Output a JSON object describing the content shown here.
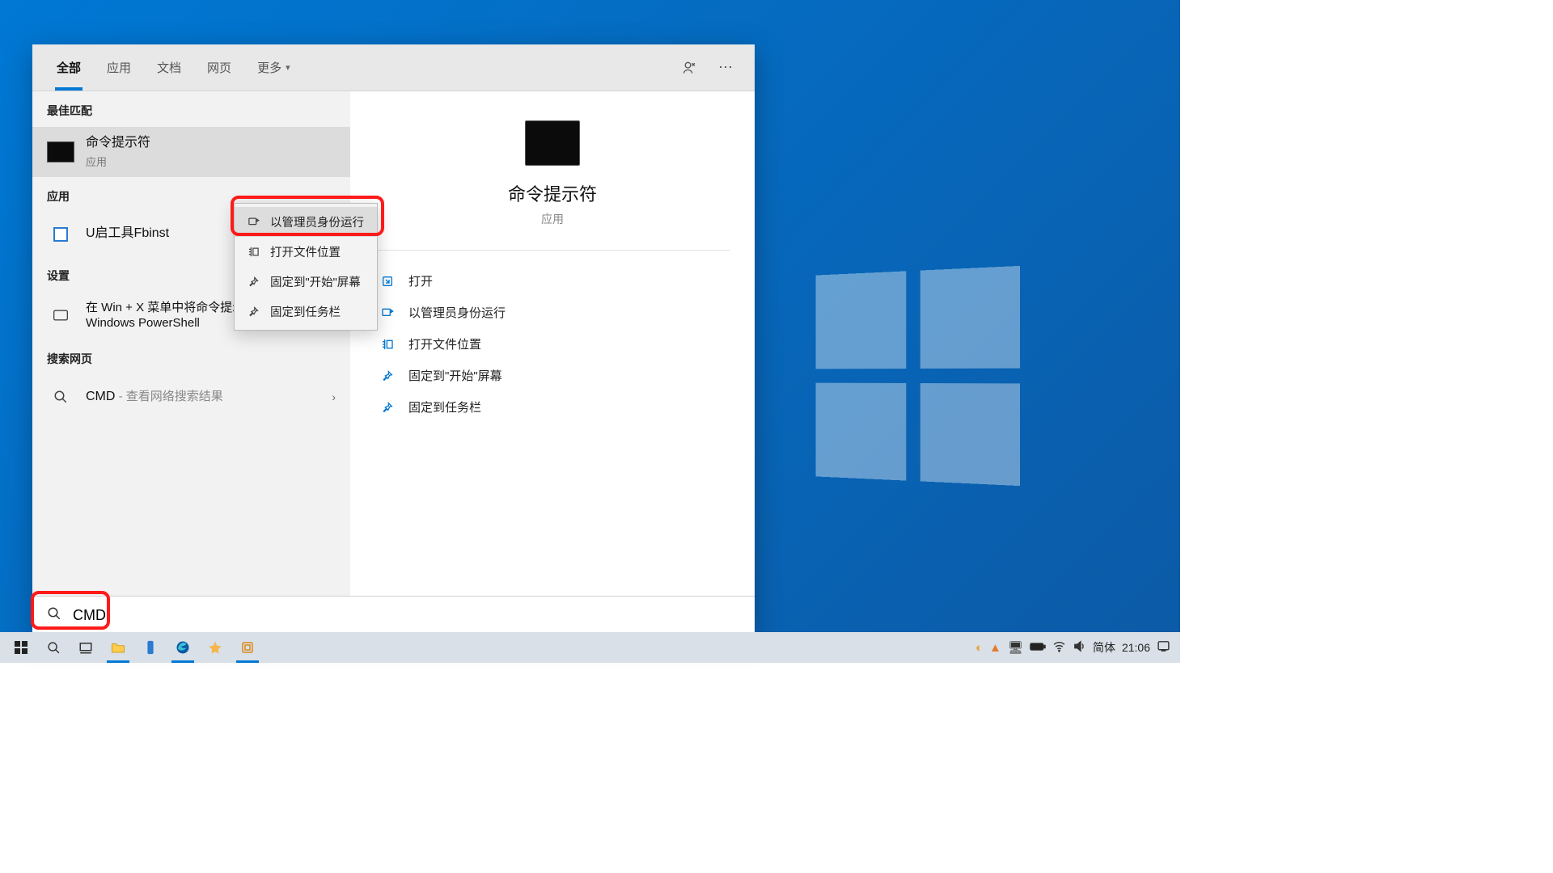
{
  "desktop": {},
  "search_panel": {
    "tabs": {
      "all": "全部",
      "apps": "应用",
      "docs": "文档",
      "web": "网页",
      "more": "更多"
    },
    "sections": {
      "best_match": "最佳匹配",
      "apps": "应用",
      "settings": "设置",
      "search_web": "搜索网页"
    },
    "best_match": {
      "title": "命令提示符",
      "subtitle": "应用"
    },
    "app_result": {
      "title": "U启工具Fbinst"
    },
    "setting_result": {
      "title": "在 Win + X 菜单中将命令提示符替换为 Windows PowerShell"
    },
    "web_result": {
      "prefix": "CMD",
      "suffix": " - 查看网络搜索结果"
    },
    "detail": {
      "title": "命令提示符",
      "subtitle": "应用",
      "actions": {
        "open": "打开",
        "admin": "以管理员身份运行",
        "open_loc": "打开文件位置",
        "pin_start": "固定到\"开始\"屏幕",
        "pin_taskbar": "固定到任务栏"
      }
    },
    "context_menu": {
      "admin": "以管理员身份运行",
      "open_loc": "打开文件位置",
      "pin_start": "固定到\"开始\"屏幕",
      "pin_taskbar": "固定到任务栏"
    },
    "search_value": "CMD"
  },
  "taskbar": {
    "ime": "简体",
    "clock": "21:06"
  }
}
